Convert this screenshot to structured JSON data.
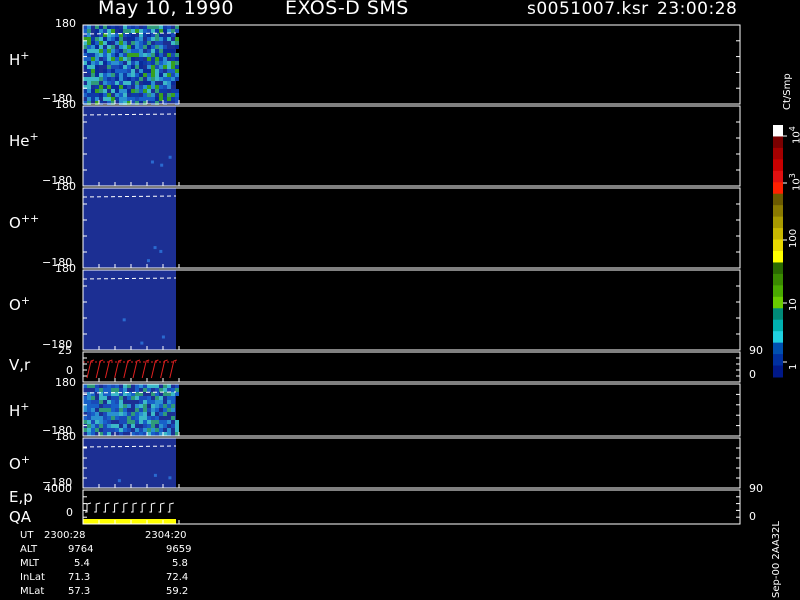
{
  "header": {
    "date": "May 10, 1990",
    "instrument": "EXOS-D SMS",
    "file": "s0051007.ksr",
    "time": "23:00:28"
  },
  "colorbar": {
    "label": "Ct/Smp",
    "ticks": [
      "10^4",
      "10^3",
      "100",
      "10",
      "1"
    ],
    "colors": [
      "#ffffff",
      "#7a0000",
      "#a40000",
      "#c80000",
      "#e01010",
      "#ff2000",
      "#6b5a00",
      "#8a7a00",
      "#a89a00",
      "#c8b800",
      "#e8d800",
      "#ffff00",
      "#2a6a00",
      "#3a8a00",
      "#4aaa00",
      "#6acc00",
      "#008a78",
      "#00b0b0",
      "#20d0e0",
      "#0050b0",
      "#0030a0",
      "#001888"
    ]
  },
  "time_axis": {
    "rows": [
      {
        "name": "UT",
        "values": [
          "2300:28",
          "2304:20"
        ]
      },
      {
        "name": "ALT",
        "values": [
          "9764",
          "9659"
        ]
      },
      {
        "name": "MLT",
        "values": [
          "5.4",
          "5.8"
        ]
      },
      {
        "name": "InLat",
        "values": [
          "71.3",
          "72.4"
        ]
      },
      {
        "name": "MLat",
        "values": [
          "57.3",
          "59.2"
        ]
      }
    ]
  },
  "footer_note": "Sep-00 2AA32L",
  "chart_data": [
    {
      "type": "heatmap",
      "species": "H",
      "charge": "+",
      "ylim": [
        -180,
        180
      ],
      "ytick_top": "180",
      "ytick_bottom": "−180",
      "colors": [
        "#0a2a9a",
        "#1860c8",
        "#2a90d0",
        "#3cb8c8",
        "#1a4ab8",
        "#0e3aa8",
        "#2f9a7a",
        "#37a020"
      ],
      "density": 0.85
    },
    {
      "type": "heatmap",
      "species": "He",
      "charge": "+",
      "ylim": [
        -180,
        180
      ],
      "ytick_top": "180",
      "ytick_bottom": "−180",
      "colors": [
        "#1c2f93"
      ],
      "density": 0.0
    },
    {
      "type": "heatmap",
      "species": "O",
      "charge": "++",
      "ylim": [
        -180,
        180
      ],
      "ytick_top": "180",
      "ytick_bottom": "−180",
      "colors": [
        "#1c2f93"
      ],
      "density": 0.0
    },
    {
      "type": "heatmap",
      "species": "O",
      "charge": "+",
      "ylim": [
        -180,
        180
      ],
      "ytick_top": "180",
      "ytick_bottom": "−180",
      "colors": [
        "#1c2f93"
      ],
      "density": 0.0
    },
    {
      "type": "line",
      "name": "V,r",
      "left_ticks": [
        "25",
        "0"
      ],
      "right_ticks": [
        "90",
        "0"
      ],
      "color": "#e02020"
    },
    {
      "type": "heatmap",
      "species": "H",
      "charge": "+",
      "ylim": [
        -180,
        180
      ],
      "ytick_top": "180",
      "ytick_bottom": "−180",
      "colors": [
        "#1860c8",
        "#2a90d0",
        "#3cb8c8",
        "#1a4ab8",
        "#2f9a7a"
      ],
      "density": 0.75
    },
    {
      "type": "heatmap",
      "species": "O",
      "charge": "+",
      "ylim": [
        -180,
        180
      ],
      "ytick_top": "180",
      "ytick_bottom": "−180",
      "colors": [
        "#1c2f93"
      ],
      "density": 0.0
    },
    {
      "type": "line",
      "name": "E,p",
      "name2": "QA",
      "left_ticks": [
        "4000",
        "0"
      ],
      "right_ticks": [
        "90",
        "0"
      ],
      "color": "#ffffff",
      "qa_color": "#ffff00"
    }
  ]
}
